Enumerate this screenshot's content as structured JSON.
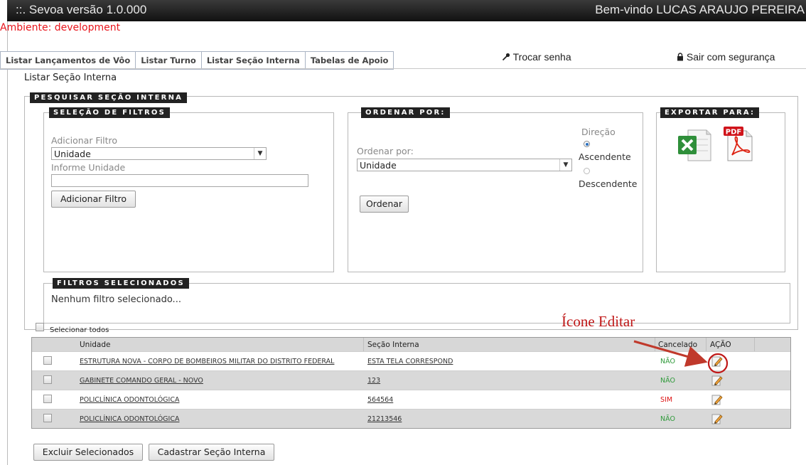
{
  "app": {
    "title": "::.  Sevoa versão 1.0.000",
    "welcome": "Bem-vindo LUCAS ARAUJO PEREIRA",
    "environment": "Ambiente: development"
  },
  "tabs": [
    {
      "label": "Listar Lançamentos de Vôo"
    },
    {
      "label": "Listar Turno"
    },
    {
      "label": "Listar Seção Interna"
    },
    {
      "label": "Tabelas de Apoio"
    }
  ],
  "links": {
    "change_password": "Trocar senha",
    "logout": "Sair com segurança"
  },
  "breadcrumb": "Listar Seção Interna",
  "search": {
    "legend": "PESQUISAR SEÇÃO INTERNA",
    "filters": {
      "legend": "SELEÇÃO DE FILTROS",
      "add_filter_label": "Adicionar Filtro",
      "filter_select_value": "Unidade",
      "inform_label": "Informe Unidade",
      "inform_value": "",
      "add_filter_button": "Adicionar Filtro"
    },
    "order": {
      "legend": "ORDENAR POR:",
      "order_by_label": "Ordenar por:",
      "order_select_value": "Unidade",
      "direction_label": "Direção",
      "ascending": "Ascendente",
      "descending": "Descendente",
      "selected_direction": "Ascendente",
      "button": "Ordenar"
    },
    "export": {
      "legend": "EXPORTAR PARA:",
      "pdf_badge": "PDF"
    },
    "selected_filters": {
      "legend": "FILTROS SELECIONADOS",
      "text": "Nenhum filtro selecionado..."
    }
  },
  "select_all": "Selecionar todos",
  "annotation": "Ícone Editar",
  "colors": {
    "annotation": "#c01818",
    "nao": "#2f9a3a",
    "sim": "#dd1111",
    "environment": "#e8141b"
  },
  "table": {
    "headers": {
      "unidade": "Unidade",
      "secao": "Seção Interna",
      "cancelado": "Cancelado",
      "acao": "AÇÃO"
    },
    "rows": [
      {
        "unidade": "ESTRUTURA NOVA - CORPO DE BOMBEIROS MILITAR DO DISTRITO FEDERAL",
        "secao": "ESTA TELA CORRESPOND",
        "cancelado": "NÃO"
      },
      {
        "unidade": "GABINETE COMANDO GERAL - NOVO",
        "secao": "123",
        "cancelado": "NÃO"
      },
      {
        "unidade": "POLICLÍNICA ODONTOLÓGICA",
        "secao": "564564",
        "cancelado": "SIM"
      },
      {
        "unidade": "POLICLÍNICA ODONTOLÓGICA",
        "secao": "21213546",
        "cancelado": "NÃO"
      }
    ]
  },
  "actions": {
    "delete_selected": "Excluir Selecionados",
    "register": "Cadastrar Seção Interna"
  }
}
